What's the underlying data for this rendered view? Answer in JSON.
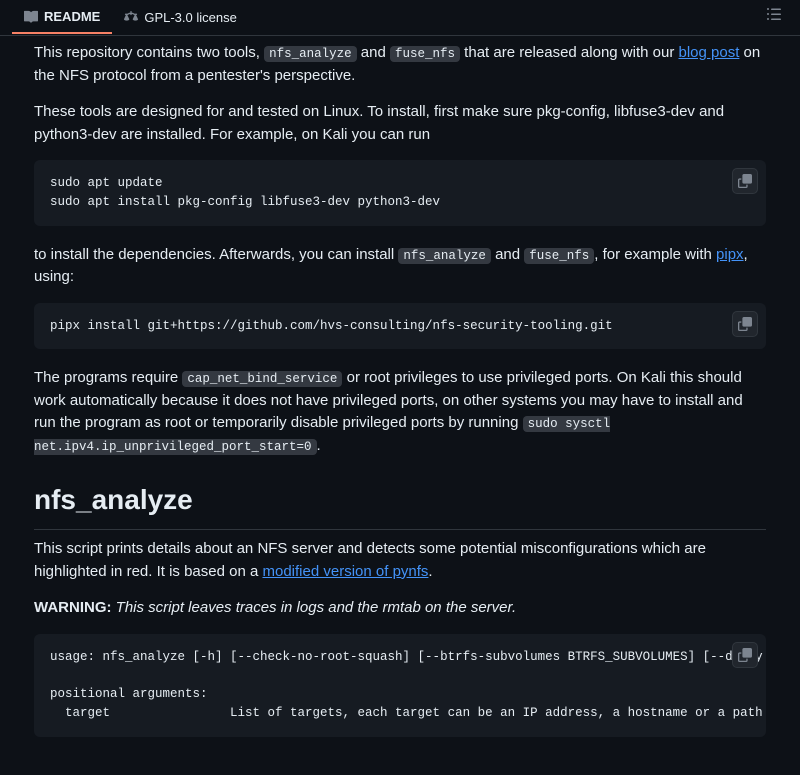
{
  "tabs": {
    "readme": "README",
    "license": "GPL-3.0 license"
  },
  "intro": {
    "p1_a": "This repository contains two tools, ",
    "c1": "nfs_analyze",
    "p1_b": " and ",
    "c2": "fuse_nfs",
    "p1_c": " that are released along with our ",
    "link1": "blog post",
    "p1_d": " on the NFS protocol from a pentester's perspective.",
    "p2": "These tools are designed for and tested on Linux. To install, first make sure pkg-config, libfuse3-dev and python3-dev are installed. For example, on Kali you can run"
  },
  "code1": "sudo apt update\nsudo apt install pkg-config libfuse3-dev python3-dev",
  "after1": {
    "a": "to install the dependencies. Afterwards, you can install ",
    "c1": "nfs_analyze",
    "b": " and ",
    "c2": "fuse_nfs",
    "c": ", for example with ",
    "link": "pipx",
    "d": ", using:"
  },
  "code2": "pipx install git+https://github.com/hvs-consulting/nfs-security-tooling.git",
  "priv": {
    "a": "The programs require ",
    "c1": "cap_net_bind_service",
    "b": " or root privileges to use privileged ports. On Kali this should work automatically because it does not have privileged ports, on other systems you may have to install and run the program as root or temporarily disable privileged ports by running ",
    "c2": "sudo sysctl net.ipv4.ip_unprivileged_port_start=0",
    "c": "."
  },
  "heading": "nfs_analyze",
  "desc": {
    "a": "This script prints details about an NFS server and detects some potential misconfigurations which are highlighted in red. It is based on a ",
    "link": "modified version of pynfs",
    "b": "."
  },
  "warn": {
    "label": "WARNING:",
    "text": " This script leaves traces in logs and the rmtab on the server."
  },
  "code3": "usage: nfs_analyze [-h] [--check-no-root-squash] [--btrfs-subvolumes BTRFS_SUBVOLUMES] [--delay DELAY]\n\npositional arguments:\n  target                List of targets, each target can be an IP address, a hostname or a path to a fi"
}
